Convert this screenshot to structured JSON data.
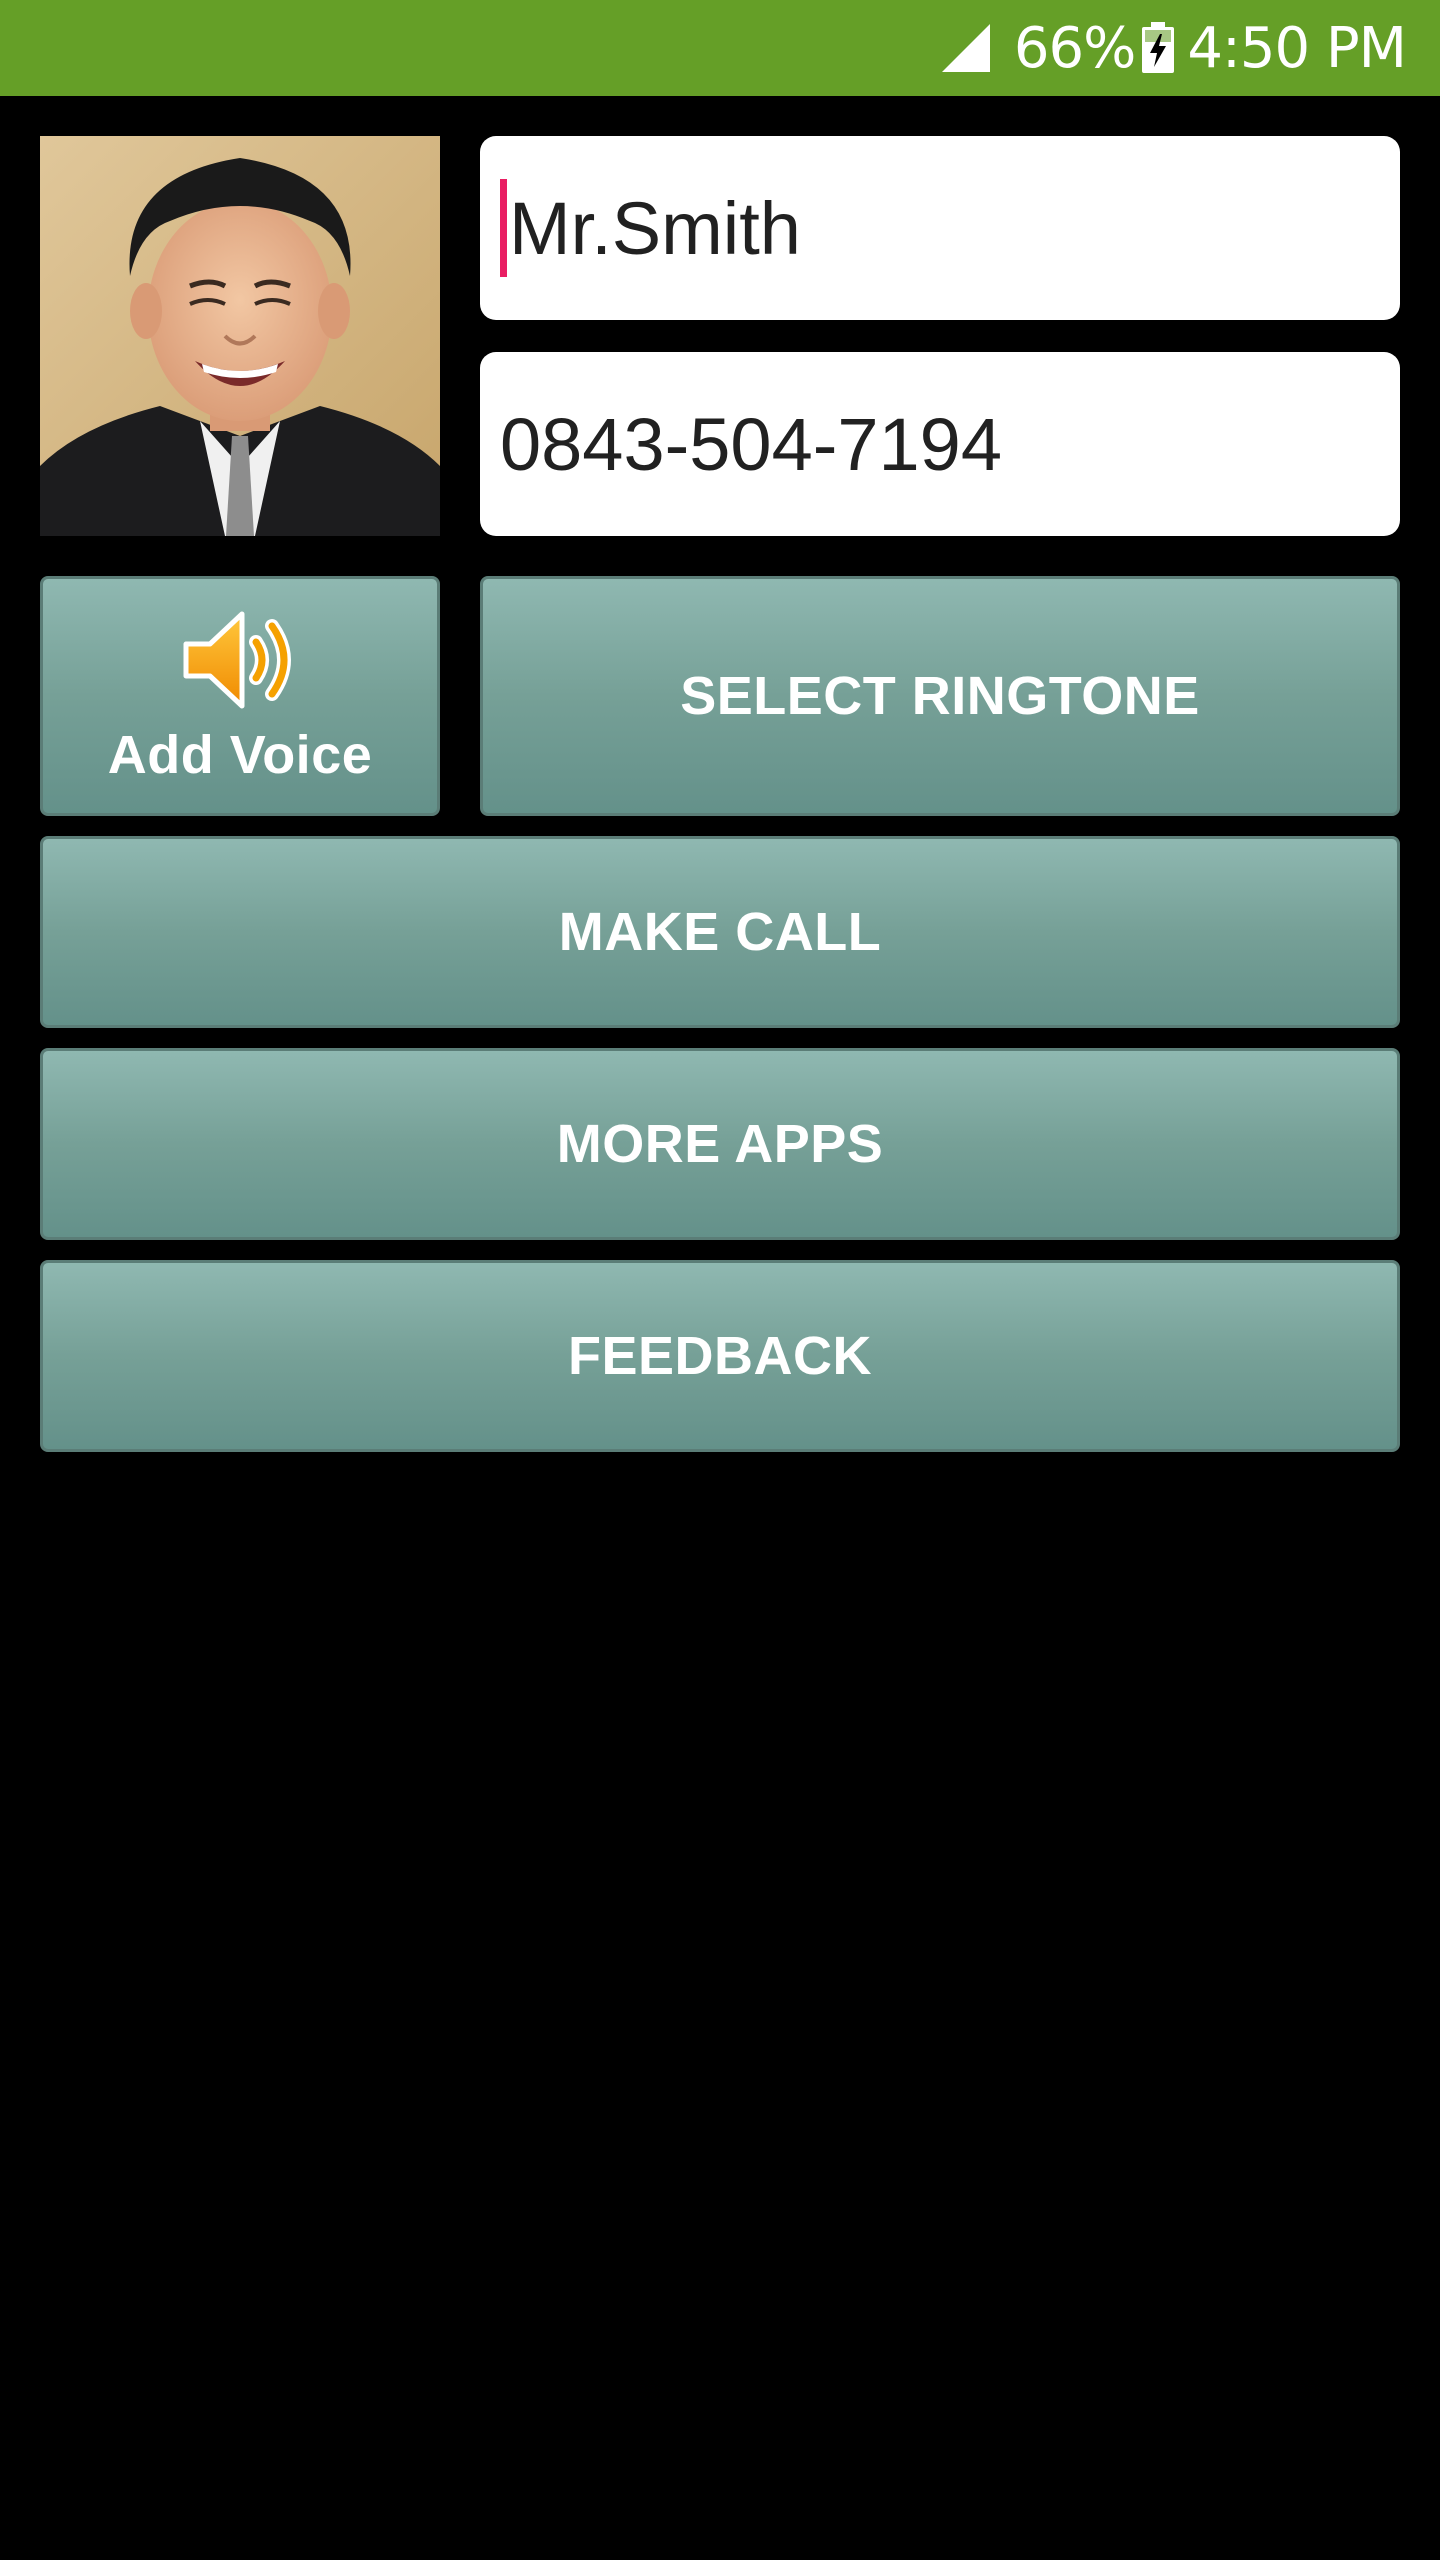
{
  "status_bar": {
    "battery_percent": "66%",
    "time": "4:50 PM",
    "signal_icon": "signal-icon",
    "battery_icon": "battery-charging-icon",
    "background_color": "#659f27"
  },
  "caller": {
    "photo_alt": "caller photo",
    "name_value": "Mr.Smith",
    "phone_value": "0843-504-7194"
  },
  "buttons": {
    "add_voice": "Add Voice",
    "add_voice_icon": "speaker-icon",
    "select_ringtone": "SELECT RINGTONE",
    "make_call": "MAKE CALL",
    "more_apps": "MORE APPS",
    "feedback": "FEEDBACK"
  },
  "colors": {
    "button_top": "#8fb8b1",
    "button_bottom": "#64918a",
    "cursor": "#e91e63"
  }
}
